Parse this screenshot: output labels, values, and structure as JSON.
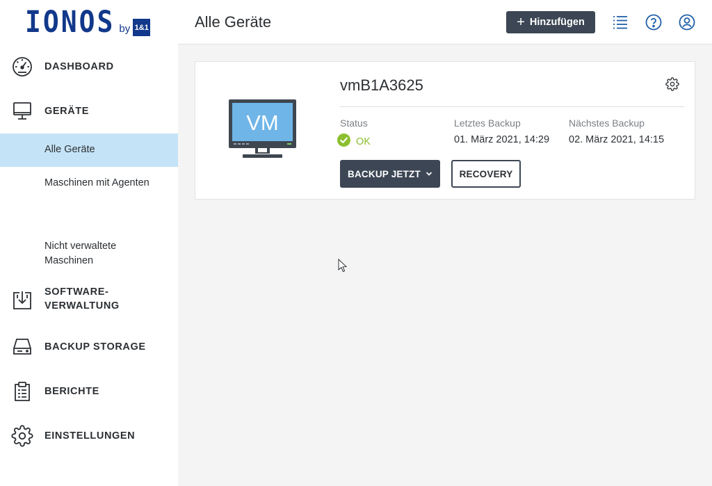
{
  "brand": {
    "logo_word": "IONOS",
    "logo_by": "by",
    "logo_badge": "1&1",
    "color": "#11388a"
  },
  "sidebar": {
    "items": [
      {
        "label": "DASHBOARD",
        "icon": "gauge-icon"
      },
      {
        "label": "GERÄTE",
        "icon": "monitor-icon"
      },
      {
        "label": "SOFTWARE-\nVERWALTUNG",
        "icon": "software-download-icon"
      },
      {
        "label": "BACKUP STORAGE",
        "icon": "storage-drive-icon"
      },
      {
        "label": "BERICHTE",
        "icon": "clipboard-report-icon"
      },
      {
        "label": "EINSTELLUNGEN",
        "icon": "gear-icon"
      }
    ],
    "subitems": [
      {
        "label": "Alle Geräte",
        "active": true
      },
      {
        "label": "Maschinen mit Agenten",
        "active": false
      },
      {
        "label": "Nicht verwaltete Maschinen",
        "active": false
      }
    ],
    "active_bg": "#c5e3f6"
  },
  "header": {
    "title": "Alle Geräte",
    "add_label": "Hinzufügen",
    "icons": [
      "list-view-icon",
      "help-icon",
      "user-account-icon"
    ]
  },
  "device": {
    "name": "vmB1A3625",
    "image_label": "VM",
    "status_label": "Status",
    "status_value": "OK",
    "last_backup_label": "Letztes Backup",
    "last_backup_value": "01. März 2021, 14:29",
    "next_backup_label": "Nächstes Backup",
    "next_backup_value": "02. März 2021, 14:15",
    "backup_button": "BACKUP JETZT",
    "recovery_button": "RECOVERY",
    "status_color": "#8cbf2f",
    "button_color": "#3c4654"
  }
}
